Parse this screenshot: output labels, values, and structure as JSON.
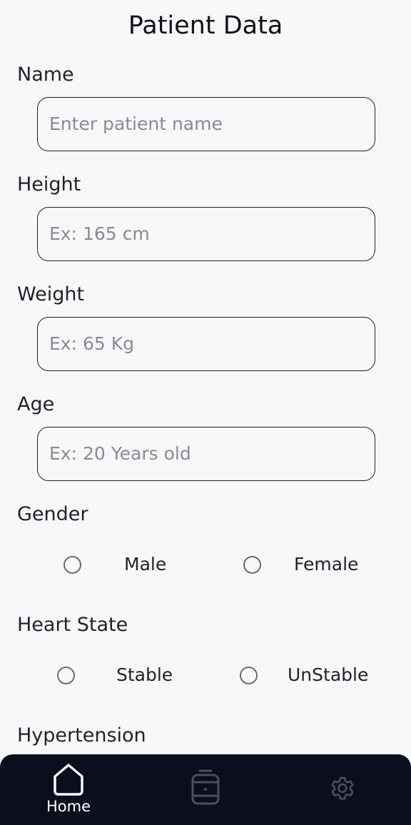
{
  "header": {
    "title": "Patient Data"
  },
  "form": {
    "name": {
      "label": "Name",
      "placeholder": "Enter patient name"
    },
    "height": {
      "label": "Height",
      "placeholder": "Ex: 165 cm"
    },
    "weight": {
      "label": "Weight",
      "placeholder": "Ex: 65 Kg"
    },
    "age": {
      "label": "Age",
      "placeholder": "Ex: 20 Years old"
    },
    "gender": {
      "label": "Gender",
      "options": [
        {
          "label": "Male",
          "selected": false
        },
        {
          "label": "Female",
          "selected": false
        }
      ]
    },
    "heart_state": {
      "label": "Heart State",
      "options": [
        {
          "label": "Stable",
          "selected": false
        },
        {
          "label": "UnStable",
          "selected": false
        }
      ]
    },
    "hypertension": {
      "label": "Hypertension"
    }
  },
  "bottom_nav": {
    "items": [
      {
        "label": "Home",
        "icon": "home-icon",
        "active": true
      },
      {
        "label": "",
        "icon": "medicine-jar-icon",
        "active": false
      },
      {
        "label": "",
        "icon": "gear-icon",
        "active": false
      }
    ]
  },
  "colors": {
    "background": "#f8f8fa",
    "navbar": "#0b0e1d",
    "border": "#1f1f2a",
    "placeholder": "#8a8a92",
    "inactive_icon": "#4b4f60"
  }
}
